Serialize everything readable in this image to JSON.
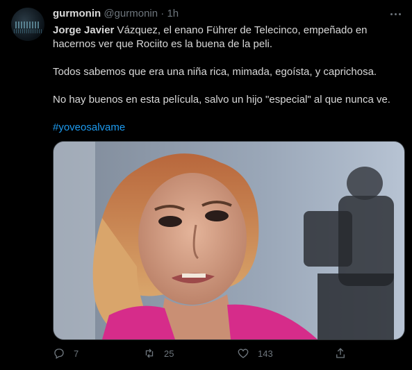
{
  "tweet": {
    "author_name": "gurmonin",
    "author_handle": "@gurmonin",
    "separator": "·",
    "time": "1h",
    "mention": "Jorge Javier",
    "line1_rest": " Vázquez, el enano Führer de Telecinco, empeñado en hacernos ver que Rociito es la buena de la peli.",
    "paragraph2": "Todos sabemos que era una niña rica, mimada, egoísta, y caprichosa.",
    "paragraph3": "No hay buenos en esta película, salvo un hijo \"especial\" al que nunca ve.",
    "hashtag": "#yoveosalvame"
  },
  "actions": {
    "reply_count": "7",
    "retweet_count": "25",
    "like_count": "143"
  },
  "icons": [
    "avatar",
    "more-icon",
    "reply-icon",
    "retweet-icon",
    "like-icon",
    "share-icon"
  ],
  "colors": {
    "background": "#000000",
    "text": "#d9d9d9",
    "muted": "#6e767d",
    "hashtag": "#1d9bf0",
    "jacket": "#d62c8a"
  }
}
